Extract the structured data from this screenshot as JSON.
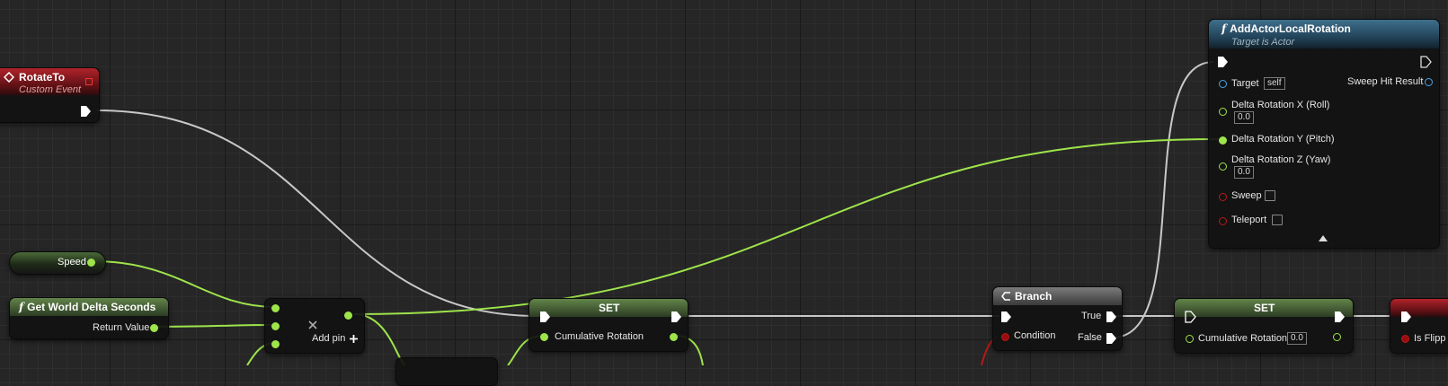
{
  "nodes": {
    "rotate_to": {
      "title": "RotateTo",
      "subtitle": "Custom Event"
    },
    "speed": {
      "label": "Speed"
    },
    "get_world_delta": {
      "title": "Get World Delta Seconds",
      "output": "Return Value"
    },
    "add": {
      "add_pin_label": "Add pin"
    },
    "set_left": {
      "title": "SET",
      "var": "Cumulative Rotation"
    },
    "add_actor_local_rotation": {
      "title": "AddActorLocalRotation",
      "subtitle": "Target is Actor",
      "target_label": "Target",
      "target_value": "self",
      "sweep_hit_label": "Sweep Hit Result",
      "delta_x_label": "Delta Rotation X (Roll)",
      "delta_x_value": "0.0",
      "delta_y_label": "Delta Rotation Y (Pitch)",
      "delta_z_label": "Delta Rotation Z (Yaw)",
      "delta_z_value": "0.0",
      "sweep_label": "Sweep",
      "teleport_label": "Teleport"
    },
    "branch": {
      "title": "Branch",
      "condition": "Condition",
      "true_label": "True",
      "false_label": "False"
    },
    "set_right": {
      "title": "SET",
      "var": "Cumulative Rotation",
      "value": "0.0"
    },
    "partial": {
      "label": "Is Flipp"
    }
  },
  "icons": [
    "event-icon",
    "function-icon",
    "branch-icon",
    "remove-icon",
    "add-icon",
    "collapse-arrow-icon"
  ],
  "colors": {
    "exec": "#ffffff",
    "float": "#9ee44b",
    "object": "#4aa3e6",
    "bool": "#b81818",
    "event_header": "#b0232a",
    "function_header": "#3f6f8c"
  }
}
